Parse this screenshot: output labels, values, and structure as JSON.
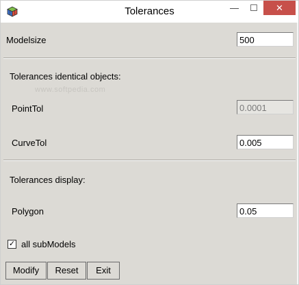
{
  "window": {
    "title": "Tolerances",
    "minimize_glyph": "—",
    "maximize_glyph": "☐",
    "close_glyph": "✕"
  },
  "modelsize": {
    "label": "Modelsize",
    "value": "500"
  },
  "identical": {
    "heading": "Tolerances identical objects:",
    "point_label": "PointTol",
    "point_value": "0.0001",
    "curve_label": "CurveTol",
    "curve_value": "0.005"
  },
  "display": {
    "heading": "Tolerances display:",
    "polygon_label": "Polygon",
    "polygon_value": "0.05"
  },
  "submodels": {
    "label": "all subModels",
    "checked": true,
    "check_glyph": "✓"
  },
  "buttons": {
    "modify": "Modify",
    "reset": "Reset",
    "exit": "Exit"
  },
  "watermark": "www.softpedia.com"
}
